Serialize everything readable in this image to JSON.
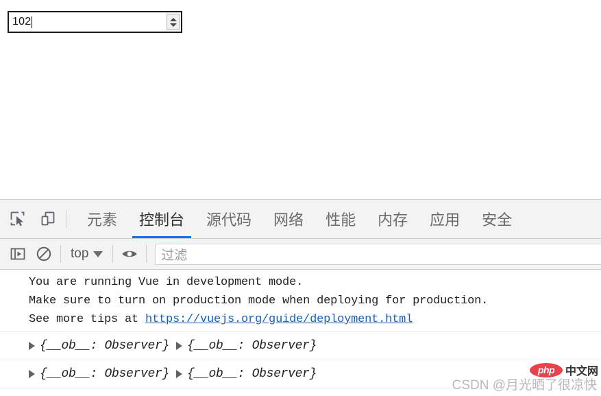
{
  "page": {
    "number_input": {
      "name": "number-input",
      "value": "102",
      "type": "number"
    }
  },
  "devtools": {
    "toolbar_icons": [
      {
        "name": "inspect-element-icon",
        "title": "检查元素"
      },
      {
        "name": "device-toolbar-icon",
        "title": "切换设备工具栏"
      }
    ],
    "tabs": [
      {
        "id": "elements",
        "label": "元素",
        "active": false
      },
      {
        "id": "console",
        "label": "控制台",
        "active": true
      },
      {
        "id": "sources",
        "label": "源代码",
        "active": false
      },
      {
        "id": "network",
        "label": "网络",
        "active": false
      },
      {
        "id": "performance",
        "label": "性能",
        "active": false
      },
      {
        "id": "memory",
        "label": "内存",
        "active": false
      },
      {
        "id": "application",
        "label": "应用",
        "active": false
      },
      {
        "id": "security",
        "label": "安全",
        "active": false
      }
    ],
    "active_tab_underline_color": "#1a73e8",
    "console_toolbar": {
      "sidebar_toggle_icon": "console-sidebar-toggle-icon",
      "clear_console_icon": "clear-console-icon",
      "context_selector": {
        "label": "top",
        "caret": "chevron-down-icon"
      },
      "eye_icon": "live-expression-eye-icon",
      "filter": {
        "placeholder": "过滤",
        "value": ""
      }
    },
    "console_messages": [
      {
        "type": "log-multiline",
        "lines": [
          {
            "text": "You are running Vue in development mode."
          },
          {
            "text": "Make sure to turn on production mode when deploying for production."
          },
          {
            "text": "See more tips at ",
            "link": "https://vuejs.org/guide/deployment.html"
          }
        ]
      },
      {
        "type": "object-row",
        "objects": [
          "{__ob__: Observer}",
          "{__ob__: Observer}"
        ]
      },
      {
        "type": "object-row",
        "objects": [
          "{__ob__: Observer}",
          "{__ob__: Observer}"
        ]
      }
    ]
  },
  "watermark": {
    "text": "CSDN @月光晒了很凉快",
    "badge_logo": "php",
    "badge_label": "中文网",
    "badge_color": "#e8424a"
  }
}
